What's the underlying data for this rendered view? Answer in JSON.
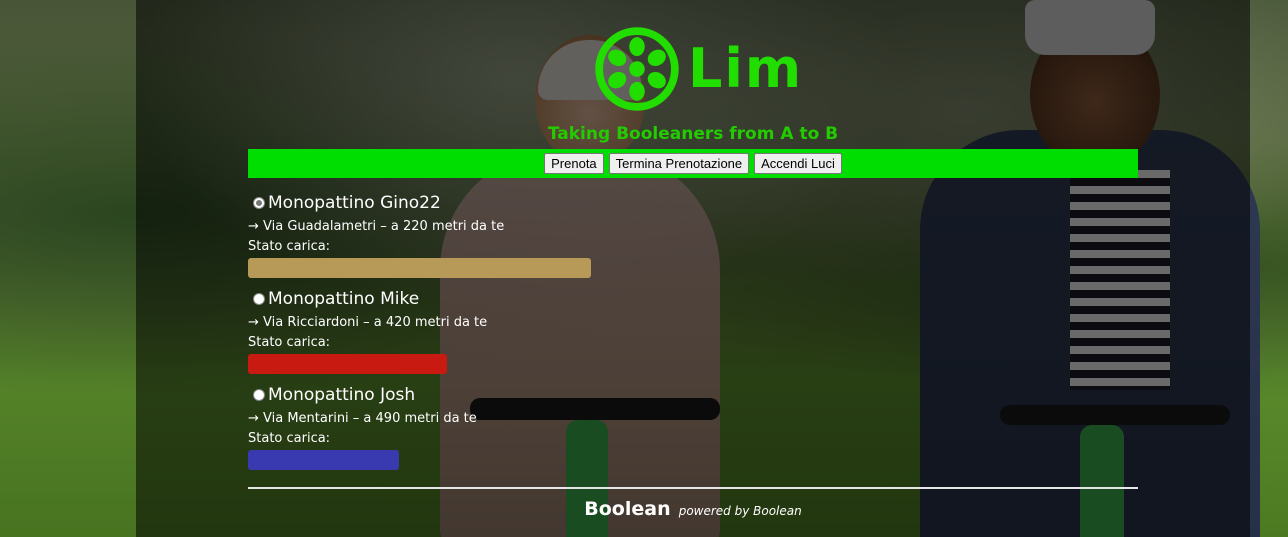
{
  "brand": {
    "logo_text": "Lim",
    "tagline": "Taking Booleaners from A to B",
    "accent_color": "#00dd00",
    "icon": "lime-wheel-icon"
  },
  "nav": {
    "buttons": [
      {
        "label": "Prenota"
      },
      {
        "label": "Termina Prenotazione"
      },
      {
        "label": "Accendi Luci"
      }
    ]
  },
  "scooters": [
    {
      "name": "Monopattino Gino22",
      "address": "→ Via Guadalametri – a 220 metri da te",
      "charge_label": "Stato carica:",
      "charge_fraction": 1.0,
      "charge_color": "#b89a58",
      "selected": true
    },
    {
      "name": "Monopattino Mike",
      "address": "→ Via Ricciardoni – a 420 metri da te",
      "charge_label": "Stato carica:",
      "charge_fraction": 0.58,
      "charge_color": "#c81a10",
      "selected": false
    },
    {
      "name": "Monopattino Josh",
      "address": "→ Via Mentarini – a 490 metri da te",
      "charge_label": "Stato carica:",
      "charge_fraction": 0.44,
      "charge_color": "#3a3ab0",
      "selected": false
    }
  ],
  "footer": {
    "brand": "Boolean",
    "powered": "powered by Boolean"
  }
}
